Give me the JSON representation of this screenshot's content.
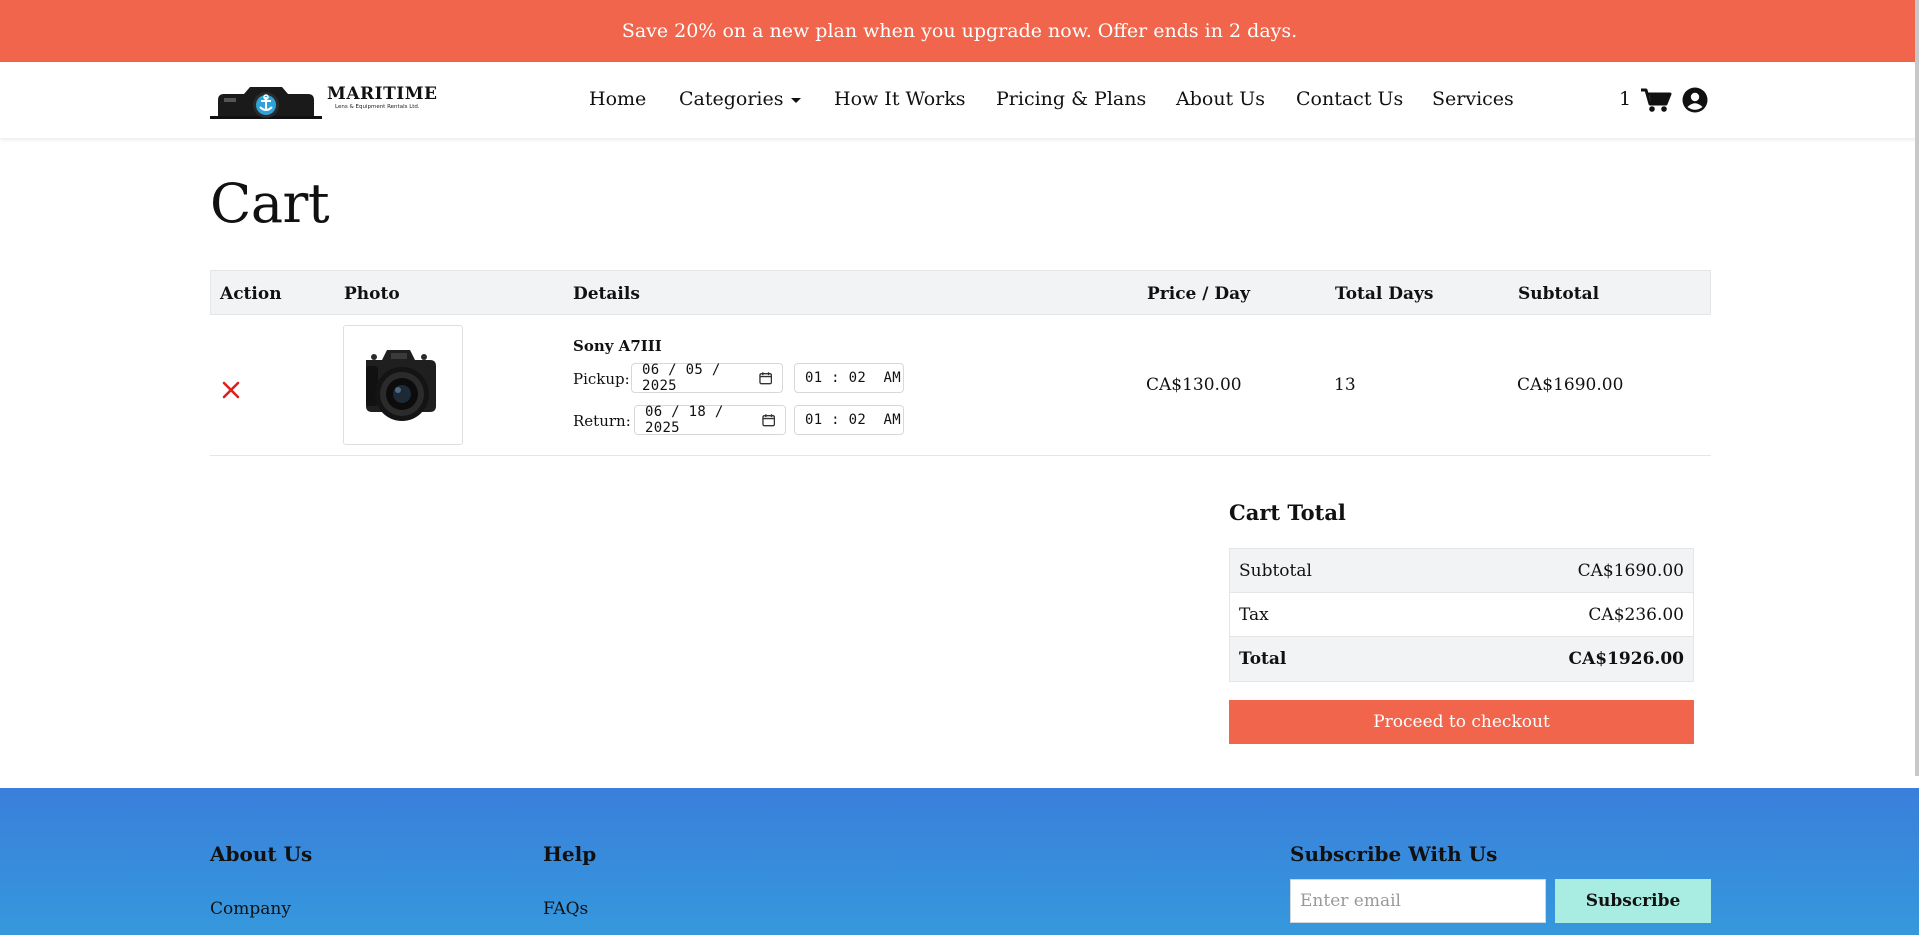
{
  "promo": {
    "text": "Save 20% on a new plan when you upgrade now. Offer ends in 2 days."
  },
  "brand": {
    "name": "MARITIME",
    "tagline": "Lens & Equipment Rentals Ltd."
  },
  "nav": {
    "items": [
      "Home",
      "Categories",
      "How It Works",
      "Pricing & Plans",
      "About Us",
      "Contact Us",
      "Services"
    ],
    "cart_count": "1"
  },
  "page": {
    "title": "Cart"
  },
  "cart_table": {
    "headers": [
      "Action",
      "Photo",
      "Details",
      "Price / Day",
      "Total Days",
      "Subtotal"
    ],
    "rows": [
      {
        "product": "Sony A7III",
        "pickup_label": "Pickup:",
        "pickup_date": "06 / 05 / 2025",
        "pickup_time": "01 : 02  AM",
        "return_label": "Return:",
        "return_date": "06 / 18 / 2025",
        "return_time": "01 : 02  AM",
        "price_per_day": "CA$130.00",
        "total_days": "13",
        "subtotal": "CA$1690.00"
      }
    ]
  },
  "cart_total": {
    "title": "Cart Total",
    "rows": [
      {
        "label": "Subtotal",
        "value": "CA$1690.00"
      },
      {
        "label": "Tax",
        "value": "CA$236.00"
      },
      {
        "label": "Total",
        "value": "CA$1926.00"
      }
    ],
    "checkout_label": "Proceed to checkout"
  },
  "footer": {
    "about_heading": "About Us",
    "about_link": "Company",
    "help_heading": "Help",
    "help_link": "FAQs",
    "subscribe_heading": "Subscribe With Us",
    "email_placeholder": "Enter email",
    "subscribe_label": "Subscribe"
  },
  "colors": {
    "accent": "#f0654b",
    "footer_blue": "#3a8bdb",
    "subscribe_button": "#a9ece1",
    "remove_icon": "#e0201c"
  },
  "icons": [
    "caret-down-icon",
    "cart-icon",
    "user-icon",
    "remove-icon",
    "calendar-icon",
    "camera-logo-icon"
  ]
}
